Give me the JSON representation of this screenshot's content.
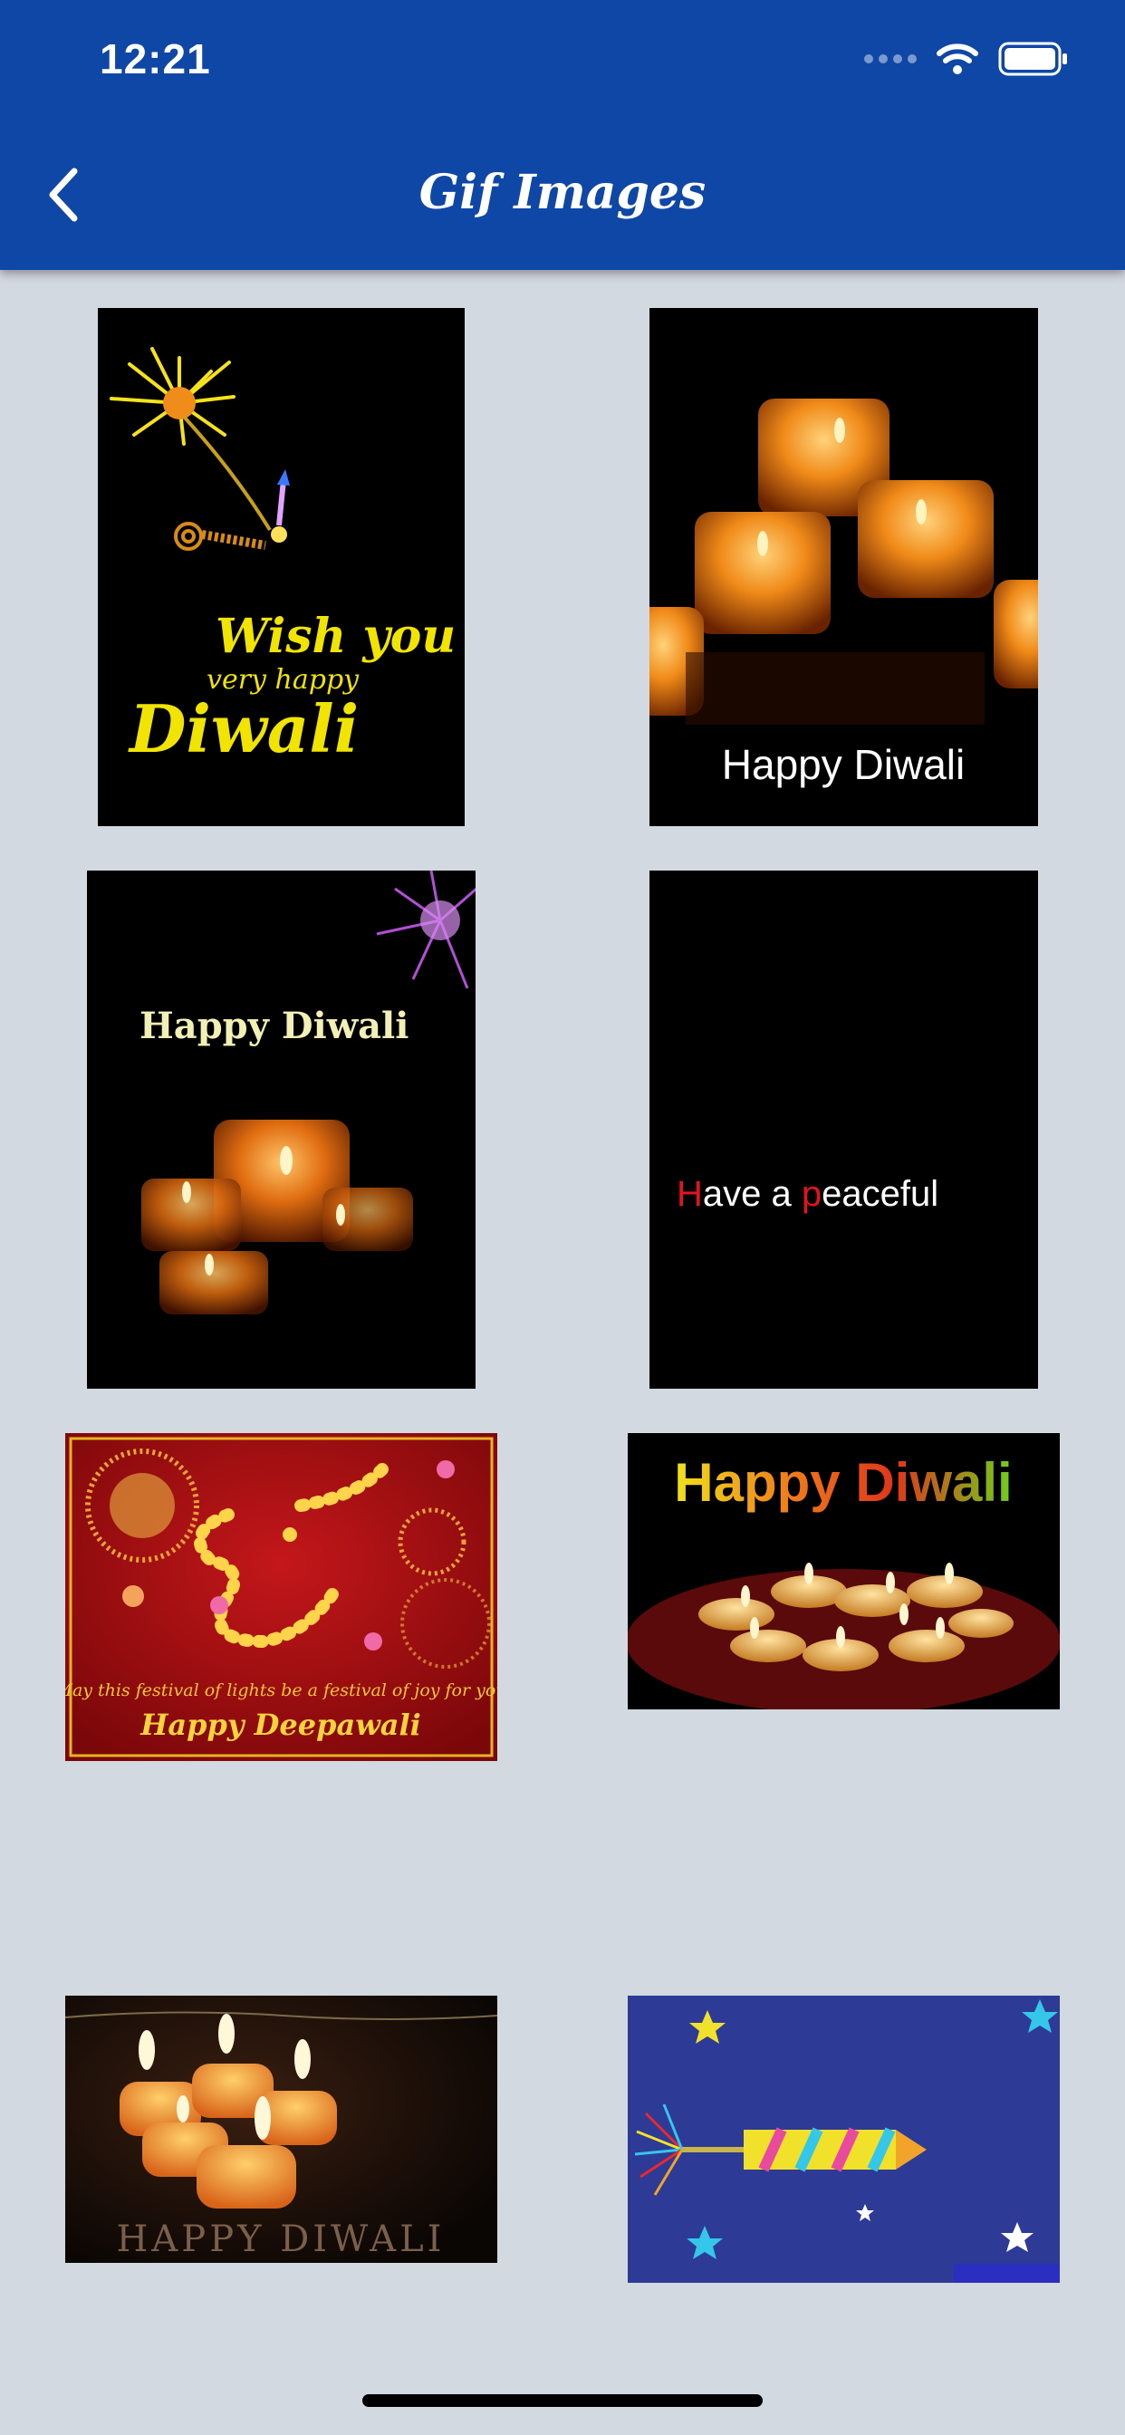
{
  "status_bar": {
    "time": "12:21"
  },
  "header": {
    "title": "Gif Images",
    "back_icon": "chevron-left-icon"
  },
  "colors": {
    "header_bg": "#0e47a6",
    "page_bg": "#d3d9e0"
  },
  "grid": {
    "items": [
      {
        "line1": "Wish you a",
        "line2": "very happy",
        "line3": "Diwali"
      },
      {
        "caption": "Happy Diwali"
      },
      {
        "caption": "Happy Diwali"
      },
      {
        "caption_first": "H",
        "caption_mid": "ave a ",
        "caption_p": "p",
        "caption_end": "eaceful"
      },
      {
        "line1": "May this festival of lights be a festival of joy for you",
        "line2": "Happy Deepawali"
      },
      {
        "caption": "Happy Diwali"
      },
      {
        "caption": "HAPPY DIWALI"
      },
      {
        "caption": ""
      }
    ]
  }
}
